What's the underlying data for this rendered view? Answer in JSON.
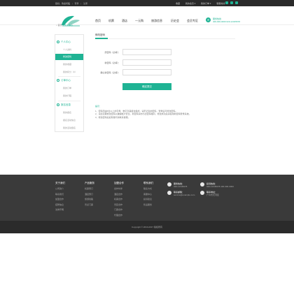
{
  "topbar": {
    "greeting": "您好，欢迎光临",
    "login": "登录",
    "register": "注册",
    "links": [
      "收藏",
      "我的会员 ▾",
      "我的订单 ▾",
      "客服热线"
    ],
    "social_icons": [
      "weibo-icon",
      "qq-icon",
      "wechat-icon"
    ]
  },
  "header": {
    "logo_icon": "leaf-logo",
    "nav": [
      "首页",
      "机票",
      "酒店",
      "一元购",
      "旅游信息",
      "历史会",
      "会员专区"
    ],
    "hotline_label": "服务热线",
    "hotline_number": "400-000-0000  020-12345678"
  },
  "breadcrumb": {
    "home": "首页",
    "sep": ">",
    "current": "个人中心"
  },
  "sidebar": {
    "groups": [
      {
        "title": "个人中心",
        "items": [
          "个人资料",
          "修改密码",
          "我的收藏",
          "我的积分（0）"
        ],
        "active": 1
      },
      {
        "title": "订单中心",
        "items": [
          "我的订单",
          "我的行程"
        ]
      },
      {
        "title": "报名信息",
        "items": [
          "我的报名",
          "报名活动信息",
          "我的活动报名"
        ]
      }
    ]
  },
  "main": {
    "tab_title": "修改密码",
    "fields": [
      {
        "label": "原密码（必填）：",
        "placeholder": ""
      },
      {
        "label": "新密码（必填）：",
        "placeholder": ""
      },
      {
        "label": "确认新密码（必填）：",
        "placeholder": ""
      }
    ],
    "submit": "确定提交",
    "tips_title": "提示：",
    "tips": [
      "1、密码须由6位以上的字母、数字及其组合组成，请牢记您的密码，登录后可修改密码。",
      "2、请您定期修改密码以确保帐户安全，新密码请勿与旧密码相同，修改成功后请使用新密码登录系统。",
      "3、修改密码后如有疑问请联系客服。"
    ]
  },
  "footer": {
    "cols": [
      {
        "title": "关于我们",
        "items": [
          "公司简介",
          "联系我们",
          "加盟合作",
          "招聘信息",
          "法律声明"
        ]
      },
      {
        "title": "产品服务",
        "items": [
          "机票预订",
          "酒店预订",
          "旅游线路",
          "景点门票"
        ]
      },
      {
        "title": "加盟合作",
        "items": [
          "合作伙伴",
          "酒店合作",
          "机票合作",
          "景区合作",
          "门票合作",
          "代理合作"
        ]
      },
      {
        "title": "联系我们",
        "items": [
          "联系方式",
          "客服中心",
          "投诉建议",
          "售后服务"
        ]
      }
    ],
    "contacts": [
      {
        "label": "服务热线：",
        "value": "020-12345678"
      },
      {
        "label": "投诉热线：",
        "value": "020-12345678  400-000-0000"
      },
      {
        "label": "联系邮箱：",
        "value": "service@example.com"
      },
      {
        "label": "联系地址：",
        "value": "广州市天河区"
      }
    ],
    "copyright": "Copyright © 2010-2017 版权所有"
  },
  "colors": {
    "accent": "#1fb394",
    "dark": "#2a2a2a",
    "footer": "#3a3a3a"
  }
}
